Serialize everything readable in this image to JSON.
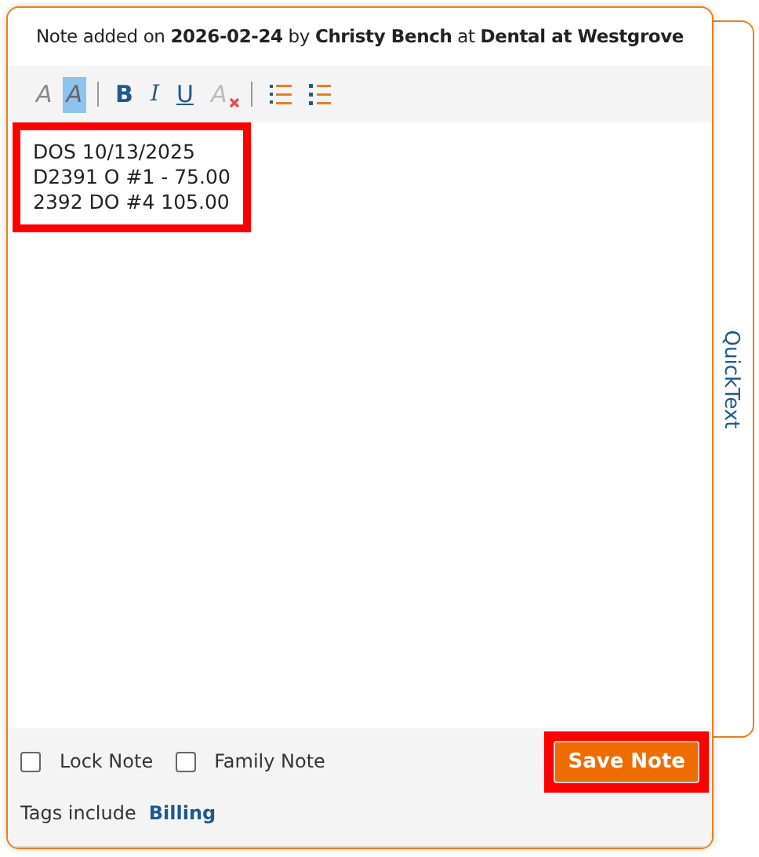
{
  "header": {
    "prefix": "Note added on",
    "date": "2026-02-24",
    "by": "by",
    "author": "Christy Bench",
    "at": "at",
    "location": "Dental at Westgrove"
  },
  "toolbar": [
    {
      "kind": "font-color",
      "label": "A"
    },
    {
      "kind": "highlight-color",
      "label": "A"
    },
    {
      "kind": "divider"
    },
    {
      "kind": "bold",
      "label": "B"
    },
    {
      "kind": "italic",
      "label": "I"
    },
    {
      "kind": "underline",
      "label": "U"
    },
    {
      "kind": "clear-format",
      "label": "A"
    },
    {
      "kind": "divider"
    },
    {
      "kind": "numbered-list"
    },
    {
      "kind": "bulleted-list"
    }
  ],
  "note_lines": [
    "DOS 10/13/2025",
    "D2391 O #1 - 75.00",
    "2392 DO #4 105.00"
  ],
  "note_highlighted": true,
  "options": [
    {
      "label": "Lock Note",
      "checked": false
    },
    {
      "label": "Family Note",
      "checked": false
    }
  ],
  "save_button": {
    "label": "Save Note",
    "highlighted": true
  },
  "tags": {
    "label": "Tags include",
    "value": "Billing"
  },
  "side_tab": {
    "label": "QuickText"
  }
}
